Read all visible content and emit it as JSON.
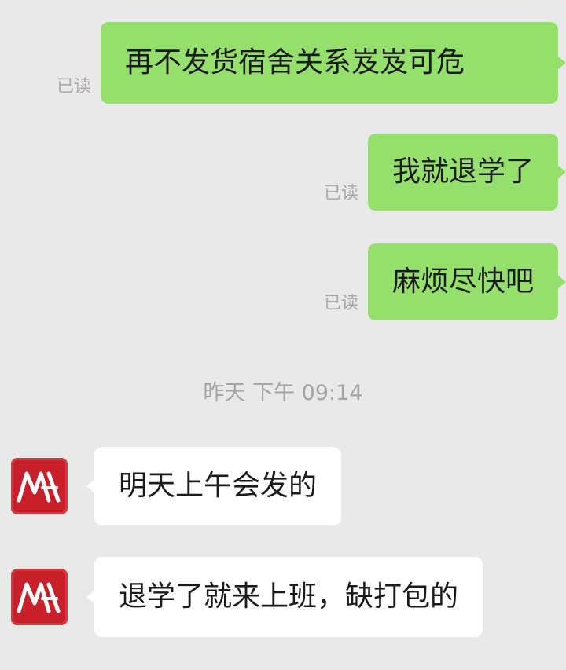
{
  "messages": [
    {
      "direction": "out",
      "text": "再不发货宿舍关系岌岌可危",
      "status": "已读"
    },
    {
      "direction": "out",
      "text": "我就退学了",
      "status": "已读"
    },
    {
      "direction": "out",
      "text": "麻烦尽快吧",
      "status": "已读"
    },
    {
      "direction": "in",
      "text": "明天上午会发的",
      "avatar": "shop-logo-icon"
    },
    {
      "direction": "in",
      "text": "退学了就来上班，缺打包的",
      "avatar": "shop-logo-icon"
    }
  ],
  "timestamp": "昨天 下午 09:14",
  "colors": {
    "background": "#e9e9e9",
    "outgoing_bubble": "#95e06c",
    "incoming_bubble": "#ffffff",
    "avatar": "#c8202a",
    "muted_text": "#a9a9a9"
  }
}
